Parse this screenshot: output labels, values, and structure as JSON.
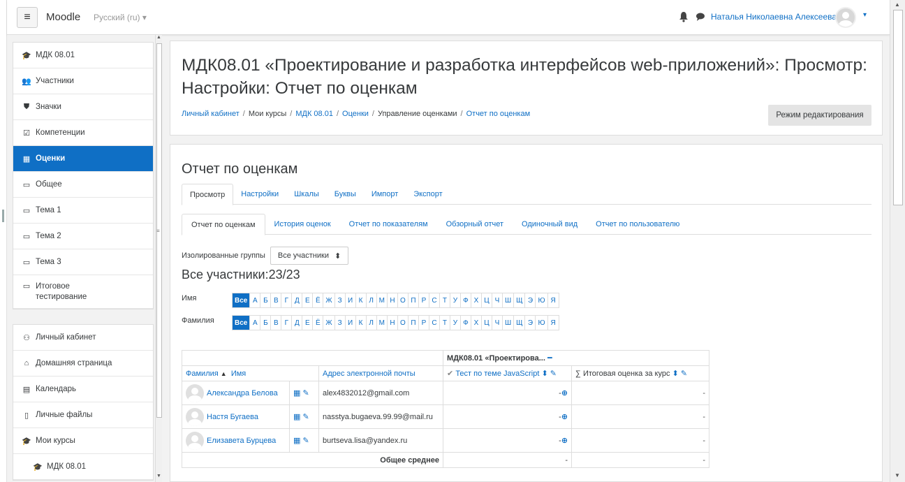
{
  "navbar": {
    "menu_icon": "hamburger-icon",
    "brand": "Moodle",
    "language": "Русский (ru) ▾",
    "user_name": "Наталья Николаевна Алексеева",
    "user_caret": "▾"
  },
  "drawer": {
    "course_items": [
      {
        "icon": "🎓",
        "label": "МДК 08.01"
      },
      {
        "icon": "👥",
        "label": "Участники"
      },
      {
        "icon": "⛊",
        "label": "Значки"
      },
      {
        "icon": "☑",
        "label": "Компетенции"
      },
      {
        "icon": "▦",
        "label": "Оценки"
      },
      {
        "icon": "▭",
        "label": "Общее"
      },
      {
        "icon": "▭",
        "label": "Тема 1"
      },
      {
        "icon": "▭",
        "label": "Тема 2"
      },
      {
        "icon": "▭",
        "label": "Тема 3"
      },
      {
        "icon": "▭",
        "label": "Итоговое тестирование"
      }
    ],
    "site_items": [
      {
        "icon": "⚇",
        "label": "Личный кабинет"
      },
      {
        "icon": "⌂",
        "label": "Домашняя страница"
      },
      {
        "icon": "▤",
        "label": "Календарь"
      },
      {
        "icon": "▯",
        "label": "Личные файлы"
      },
      {
        "icon": "🎓",
        "label": "Мои курсы"
      },
      {
        "icon": "🎓",
        "label": "МДК 08.01"
      }
    ]
  },
  "header": {
    "title": "МДК08.01 «Проектирование и разработка интерфейсов web-приложений»: Просмотр: Настройки: Отчет по оценкам",
    "breadcrumb": [
      "Личный кабинет",
      "Мои курсы",
      "МДК 08.01",
      "Оценки",
      "Управление оценками",
      "Отчет по оценкам"
    ],
    "edit_button": "Режим редактирования"
  },
  "report": {
    "title": "Отчет по оценкам",
    "main_tabs": [
      "Просмотр",
      "Настройки",
      "Шкалы",
      "Буквы",
      "Импорт",
      "Экспорт"
    ],
    "sub_tabs": [
      "Отчет по оценкам",
      "История оценок",
      "Отчет по показателям",
      "Обзорный отчет",
      "Одиночный вид",
      "Отчет по пользователю"
    ],
    "group_label": "Изолированные группы",
    "group_value": "Все участники",
    "count": "Все участники:23/23",
    "firstname_label": "Имя",
    "lastname_label": "Фамилия",
    "letters": [
      "Все",
      "А",
      "Б",
      "В",
      "Г",
      "Д",
      "Е",
      "Ё",
      "Ж",
      "З",
      "И",
      "К",
      "Л",
      "М",
      "Н",
      "О",
      "П",
      "Р",
      "С",
      "Т",
      "У",
      "Ф",
      "Х",
      "Ц",
      "Ч",
      "Ш",
      "Щ",
      "Э",
      "Ю",
      "Я"
    ]
  },
  "table": {
    "category": "МДК08.01 «Проектирова...",
    "col_name": "Фамилия ▲ / Имя",
    "col_lastname": "Фамилия",
    "col_firstname": "Имя",
    "col_email": "Адрес электронной почты",
    "col_test": "Тест по теме JavaScript",
    "col_total": "Итоговая оценка за курс",
    "rows": [
      {
        "name": "Александра Белова",
        "email": "alex4832012@gmail.com",
        "grade": "-",
        "total": "-"
      },
      {
        "name": "Настя Бугаева",
        "email": "nasstya.bugaeva.99.99@mail.ru",
        "grade": "-",
        "total": "-"
      },
      {
        "name": "Елизавета Бурцева",
        "email": "burtseva.lisa@yandex.ru",
        "grade": "-",
        "total": "-"
      }
    ],
    "average_label": "Общее среднее",
    "average_test": "-",
    "average_total": "-"
  }
}
